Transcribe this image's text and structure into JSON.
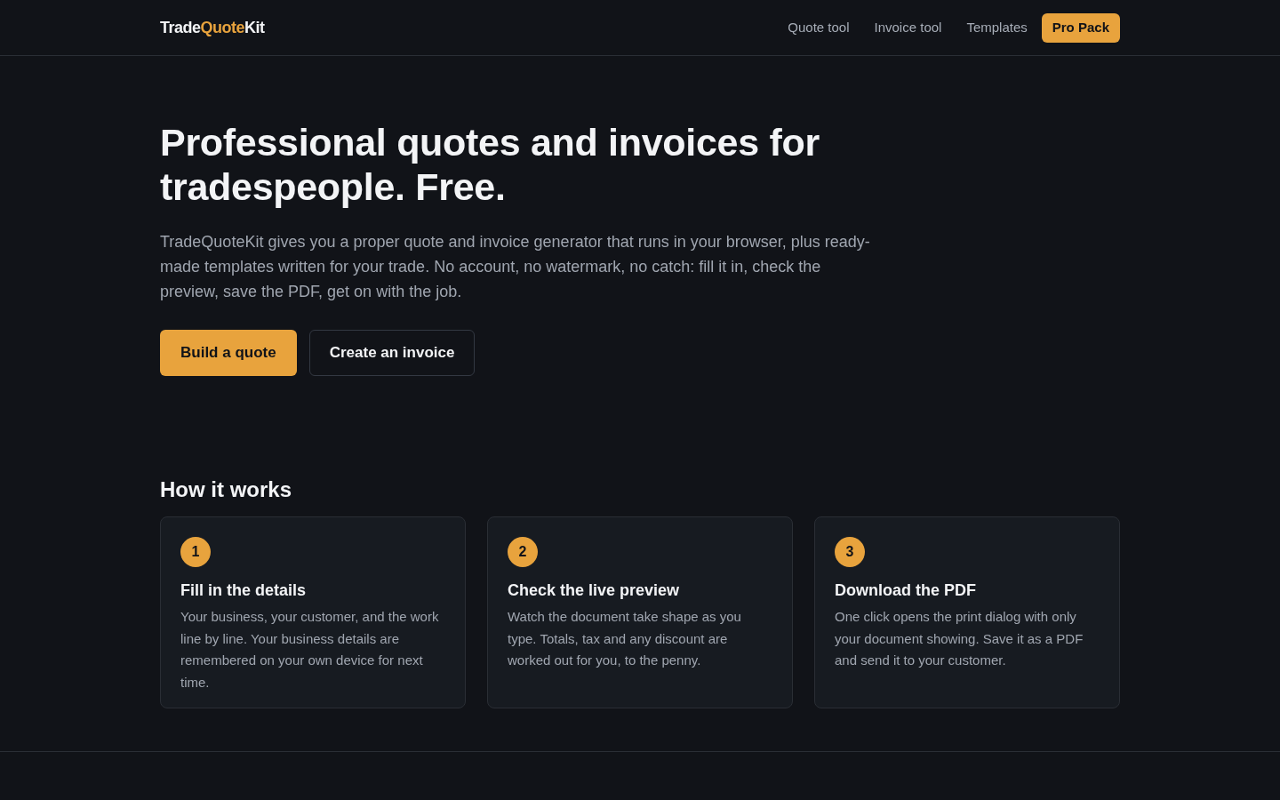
{
  "header": {
    "logo": [
      {
        "text": "Trade",
        "accent": false
      },
      {
        "text": "Quote",
        "accent": true
      },
      {
        "text": "Kit",
        "accent": false
      }
    ],
    "nav": [
      {
        "label": "Quote tool",
        "kind": "link"
      },
      {
        "label": "Invoice tool",
        "kind": "link"
      },
      {
        "label": "Templates",
        "kind": "link"
      },
      {
        "label": "Pro Pack",
        "kind": "button"
      }
    ]
  },
  "hero": {
    "title": "Professional quotes and invoices for tradespeople. Free.",
    "text": "TradeQuoteKit gives you a proper quote and invoice generator that runs in your browser, plus ready-made templates written for your trade. No account, no watermark, no catch: fill it in, check the preview, save the PDF, get on with the job.",
    "buttons": [
      {
        "label": "Build a quote",
        "kind": "primary"
      },
      {
        "label": "Create an invoice",
        "kind": "secondary"
      }
    ]
  },
  "how_it_works": {
    "title": "How it works",
    "steps": [
      {
        "number": "1",
        "title": "Fill in the details",
        "text": "Your business, your customer, and the work line by line. Your business details are remembered on your own device for next time."
      },
      {
        "number": "2",
        "title": "Check the live preview",
        "text": "Watch the document take shape as you type. Totals, tax and any discount are worked out for you, to the penny."
      },
      {
        "number": "3",
        "title": "Download the PDF",
        "text": "One click opens the print dialog with only your document showing. Save it as a PDF and send it to your customer."
      }
    ]
  }
}
